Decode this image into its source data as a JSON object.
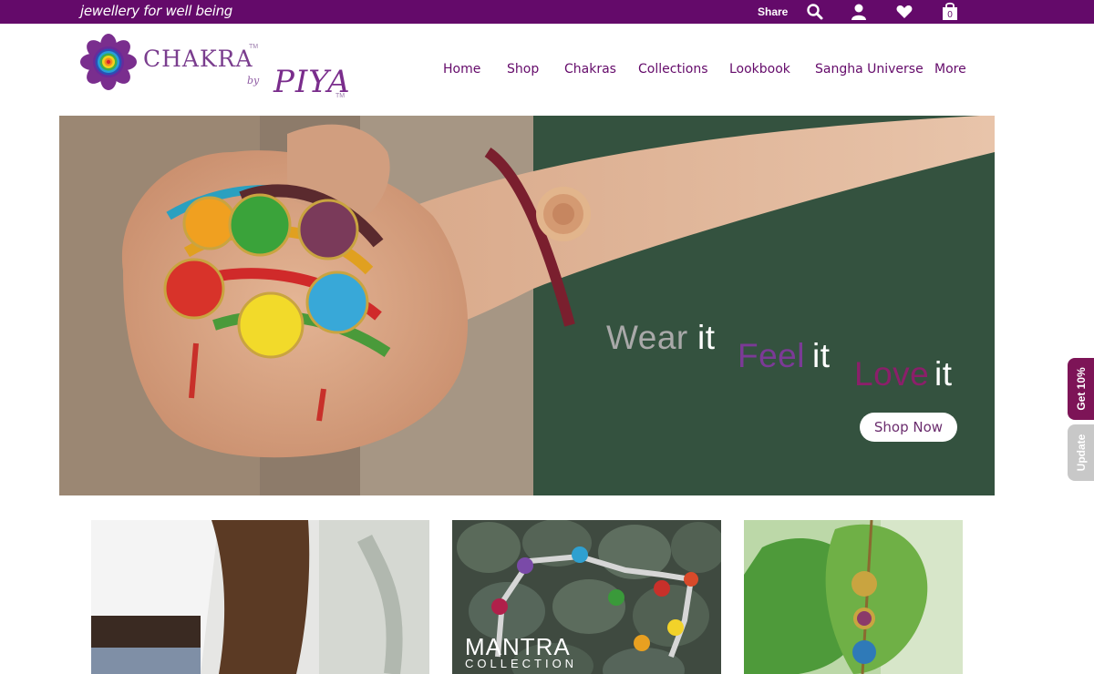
{
  "topbar": {
    "tagline": "jewellery for well being",
    "share_label": "Share",
    "cart_count": "0",
    "bg_color": "#640a6a"
  },
  "icons": {
    "search": "search-icon",
    "account": "user-icon",
    "wishlist": "heart-icon",
    "cart": "shopping-bag-icon",
    "logo_mark": "chakra-lotus-icon"
  },
  "logo": {
    "word": "CHAKRA",
    "tm": "TM",
    "by": "by",
    "brand": "PIYA"
  },
  "nav": {
    "items": [
      "Home",
      "Shop",
      "Chakras",
      "Collections",
      "Lookbook",
      "Sangha Universe",
      "More"
    ]
  },
  "hero": {
    "headline": {
      "wear": "Wear",
      "feel": "Feel",
      "love": "Love",
      "it": "it"
    },
    "cta_label": "Shop Now"
  },
  "side_tabs": {
    "discount": "Get 10%",
    "update": "Update"
  },
  "tiles": {
    "mantra_title": "MANTRA",
    "mantra_subtitle": "COLLECTION"
  },
  "colors": {
    "brand_purple": "#640a6a",
    "feel_purple": "#7b3a96",
    "love_magenta": "#8b1f6a",
    "wear_grey": "#a9a9a9",
    "discount_tab": "#7d1457",
    "update_tab": "#c8c8c8"
  }
}
